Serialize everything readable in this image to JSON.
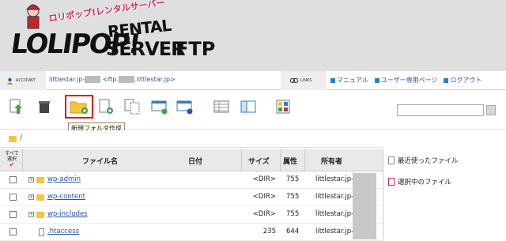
{
  "logo": {
    "tagline": "ロリポップ!レンタルサーバー",
    "main": "LOLIPOP!",
    "rental": "RENTAL",
    "server": "SERVER",
    "ftp": "FTP"
  },
  "account": {
    "badge_label": "ACCOUNT",
    "url_part1": "littlestar.jp-",
    "url_part2": " <ftp.",
    "url_part3": ".littlestar.jp>"
  },
  "links": {
    "badge_label": "LINKS",
    "items": [
      {
        "label": "マニュアル"
      },
      {
        "label": "ユーザー専用ページ"
      },
      {
        "label": "ログアウト"
      }
    ]
  },
  "toolbar": {
    "tooltip": "新規フォルダ作成",
    "icons": [
      "upload-icon",
      "delete-icon",
      "new-folder-icon",
      "new-file-icon",
      "copy-icon",
      "move-icon",
      "web-icon",
      "list-view-icon",
      "detail-view-icon",
      "theme-icon"
    ]
  },
  "path": {
    "text": "/"
  },
  "table": {
    "select_all": "すべて選択",
    "headers": {
      "name": "ファイル名",
      "date": "日付",
      "size": "サイズ",
      "attr": "属性",
      "owner": "所有者"
    },
    "rows": [
      {
        "name": "wp-admin",
        "type": "folder",
        "date": "",
        "size": "<DIR>",
        "attr": "755",
        "owner": "littlestar.jp-"
      },
      {
        "name": "wp-content",
        "type": "folder",
        "date": "",
        "size": "<DIR>",
        "attr": "755",
        "owner": "littlestar.jp-"
      },
      {
        "name": "wp-includes",
        "type": "folder",
        "date": "",
        "size": "<DIR>",
        "attr": "755",
        "owner": "littlestar.jp-"
      },
      {
        "name": ".htaccess",
        "type": "file",
        "date": "",
        "size": "235",
        "attr": "644",
        "owner": "littlestar.jp-"
      }
    ]
  },
  "side": {
    "recent": "最近使ったファイル",
    "selected": "選択中のファイル"
  }
}
